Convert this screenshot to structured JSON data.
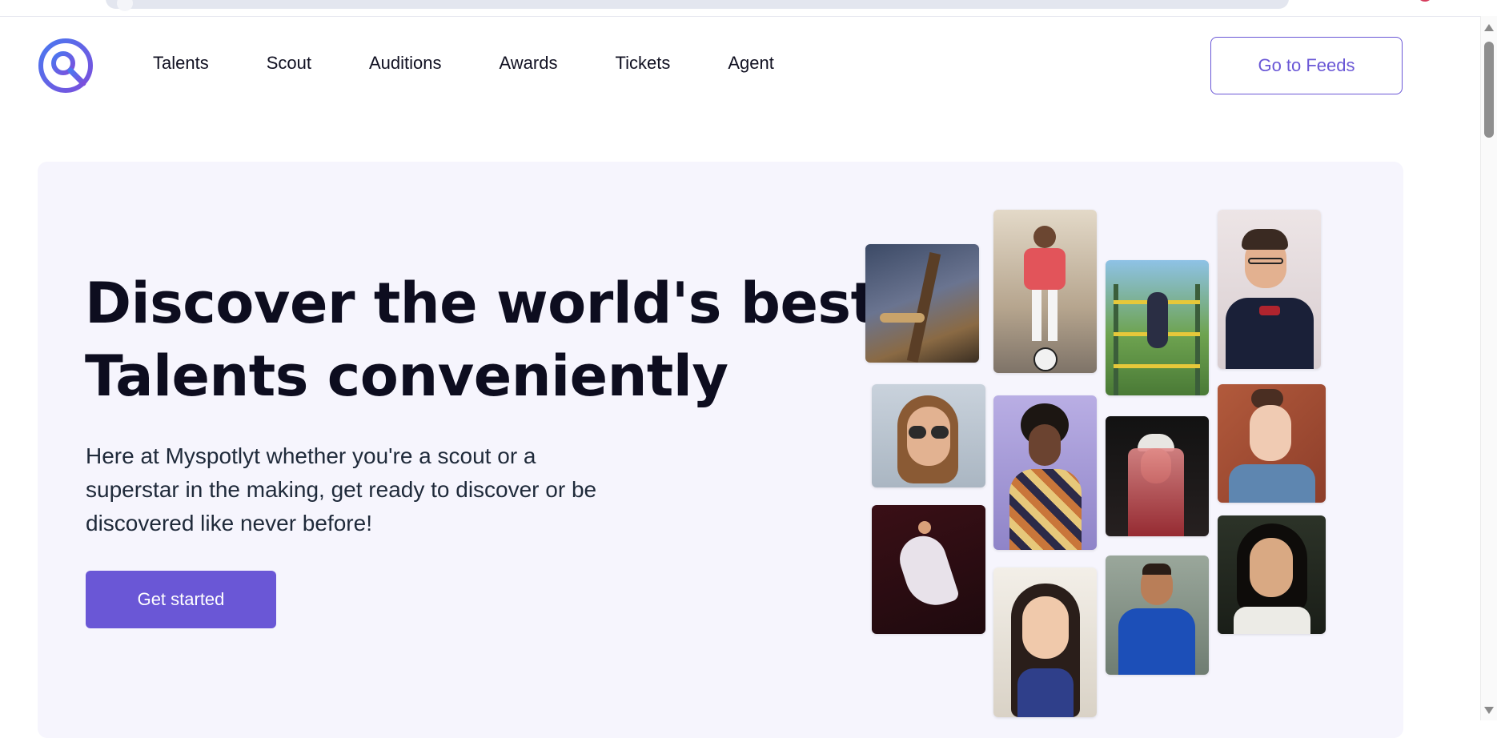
{
  "nav": {
    "logo_icon": "magnifier-logo-icon",
    "items": [
      {
        "label": "Talents"
      },
      {
        "label": "Scout"
      },
      {
        "label": "Auditions"
      },
      {
        "label": "Awards"
      },
      {
        "label": "Tickets"
      },
      {
        "label": "Agent"
      }
    ],
    "cta_label": "Go to Feeds"
  },
  "hero": {
    "headline_line1": "Discover the world's best",
    "headline_line2": "Talents conveniently",
    "subtext": "Here at Myspotlyt whether you're a scout or a superstar in the making, get ready to discover or be discovered like never before!",
    "button_label": "Get started"
  },
  "colors": {
    "brand": "#6a57d6",
    "hero_background": "#f6f5fd",
    "logo_gradient_start": "#3b82f6",
    "logo_gradient_end": "#7c4ddc"
  },
  "gallery": {
    "photos": [
      {
        "name": "painter-photo"
      },
      {
        "name": "footballer-girl-photo"
      },
      {
        "name": "gymnast-photo"
      },
      {
        "name": "bowtie-man-photo"
      },
      {
        "name": "sunglasses-woman-photo"
      },
      {
        "name": "singer-microphone-photo"
      },
      {
        "name": "rapper-photo"
      },
      {
        "name": "short-hair-woman-photo"
      },
      {
        "name": "dancer-photo"
      },
      {
        "name": "smiling-girl-photo"
      },
      {
        "name": "soccer-player-photo"
      },
      {
        "name": "dark-hair-woman-photo"
      }
    ]
  }
}
